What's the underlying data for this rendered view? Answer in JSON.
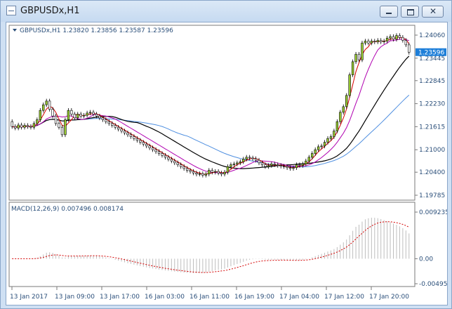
{
  "window": {
    "title": "GBPUSDx,H1",
    "icon": "chart-window-icon",
    "buttons": {
      "minimize": "minimize-icon",
      "maximize": "maximize-icon",
      "close": "✕"
    }
  },
  "price_panel": {
    "header": "GBPUSDx,H1  1.23820 1.23856 1.23587 1.23596",
    "current_price": "1.23596",
    "price_ticks": [
      "1.24060",
      "1.23445",
      "1.22845",
      "1.22230",
      "1.21615",
      "1.21000",
      "1.20400",
      "1.19785"
    ]
  },
  "macd_panel": {
    "header": "MACD(12,26,9) 0.007496 0.008174",
    "ticks": [
      "0.009235",
      "0.00",
      "-0.004953"
    ]
  },
  "time_axis": [
    "13 Jan 2017",
    "13 Jan 09:00",
    "13 Jan 17:00",
    "16 Jan 03:00",
    "16 Jan 11:00",
    "16 Jan 19:00",
    "17 Jan 04:00",
    "17 Jan 12:00",
    "17 Jan 20:00"
  ],
  "colors": {
    "bull": "#9acd32",
    "bear": "#ffffff",
    "ma_red": "#d40000",
    "ma_magenta": "#b000b0",
    "ma_black": "#000000",
    "ma_blue": "#4f8fe0",
    "macd_hist": "#bdbdbd",
    "macd_signal": "#d40000",
    "price_tag": "#1e7fd9"
  },
  "chart_data": [
    {
      "type": "candlestick",
      "title": "GBPUSDx,H1",
      "ylim": [
        1.19785,
        1.2406
      ],
      "open": [
        1.2175,
        1.2162,
        1.2158,
        1.2166,
        1.216,
        1.2165,
        1.2162,
        1.216,
        1.217,
        1.218,
        1.2205,
        1.222,
        1.223,
        1.2208,
        1.219,
        1.217,
        1.216,
        1.214,
        1.218,
        1.2205,
        1.2195,
        1.2185,
        1.2195,
        1.219,
        1.2192,
        1.2198,
        1.22,
        1.2195,
        1.219,
        1.2185,
        1.218,
        1.2175,
        1.217,
        1.2165,
        1.216,
        1.2155,
        1.215,
        1.2145,
        1.214,
        1.2135,
        1.213,
        1.2125,
        1.212,
        1.2115,
        1.211,
        1.2105,
        1.21,
        1.2095,
        1.209,
        1.2085,
        1.208,
        1.2075,
        1.207,
        1.2065,
        1.206,
        1.2055,
        1.205,
        1.2045,
        1.2042,
        1.2038,
        1.2035,
        1.2036,
        1.2032,
        1.2035,
        1.2045,
        1.204,
        1.2042,
        1.2038,
        1.2035,
        1.204,
        1.2055,
        1.206,
        1.2062,
        1.2065,
        1.2068,
        1.2075,
        1.208,
        1.2078,
        1.2076,
        1.2072,
        1.2065,
        1.206,
        1.2055,
        1.2058,
        1.2062,
        1.206,
        1.2058,
        1.2056,
        1.2055,
        1.2052,
        1.205,
        1.2052,
        1.206,
        1.2058,
        1.2062,
        1.207,
        1.208,
        1.209,
        1.21,
        1.2108,
        1.211,
        1.212,
        1.213,
        1.2135,
        1.215,
        1.2175,
        1.22,
        1.2215,
        1.2245,
        1.23,
        1.2335,
        1.2355,
        1.234,
        1.2385,
        1.239,
        1.2385,
        1.239,
        1.2388,
        1.2392,
        1.2388,
        1.239,
        1.2398,
        1.2402,
        1.2395,
        1.2405,
        1.24,
        1.2392,
        1.238
      ],
      "close": [
        1.2162,
        1.2158,
        1.2166,
        1.216,
        1.2165,
        1.2162,
        1.216,
        1.217,
        1.218,
        1.2205,
        1.222,
        1.223,
        1.2208,
        1.219,
        1.217,
        1.216,
        1.214,
        1.218,
        1.2205,
        1.2195,
        1.2185,
        1.2195,
        1.219,
        1.2192,
        1.2198,
        1.22,
        1.2195,
        1.219,
        1.2185,
        1.218,
        1.2175,
        1.217,
        1.2165,
        1.216,
        1.2155,
        1.215,
        1.2145,
        1.214,
        1.2135,
        1.213,
        1.2125,
        1.212,
        1.2115,
        1.211,
        1.2105,
        1.21,
        1.2095,
        1.209,
        1.2085,
        1.208,
        1.2075,
        1.207,
        1.2065,
        1.206,
        1.2055,
        1.205,
        1.2045,
        1.2042,
        1.2038,
        1.2035,
        1.2036,
        1.2032,
        1.2035,
        1.2045,
        1.204,
        1.2042,
        1.2038,
        1.2035,
        1.204,
        1.2055,
        1.206,
        1.2062,
        1.2065,
        1.2068,
        1.2075,
        1.208,
        1.2078,
        1.2076,
        1.2072,
        1.2065,
        1.206,
        1.2055,
        1.2058,
        1.2062,
        1.206,
        1.2058,
        1.2056,
        1.2055,
        1.2052,
        1.205,
        1.2052,
        1.206,
        1.2058,
        1.2062,
        1.207,
        1.208,
        1.209,
        1.21,
        1.2108,
        1.211,
        1.212,
        1.213,
        1.2135,
        1.215,
        1.2175,
        1.22,
        1.2215,
        1.2245,
        1.23,
        1.2335,
        1.2355,
        1.234,
        1.2385,
        1.239,
        1.2385,
        1.239,
        1.2388,
        1.2392,
        1.2388,
        1.239,
        1.2398,
        1.2402,
        1.2395,
        1.2405,
        1.24,
        1.2392,
        1.238,
        1.236
      ]
    },
    {
      "type": "bar",
      "title": "MACD(12,26,9)",
      "ylim": [
        -0.004953,
        0.009235
      ]
    }
  ]
}
